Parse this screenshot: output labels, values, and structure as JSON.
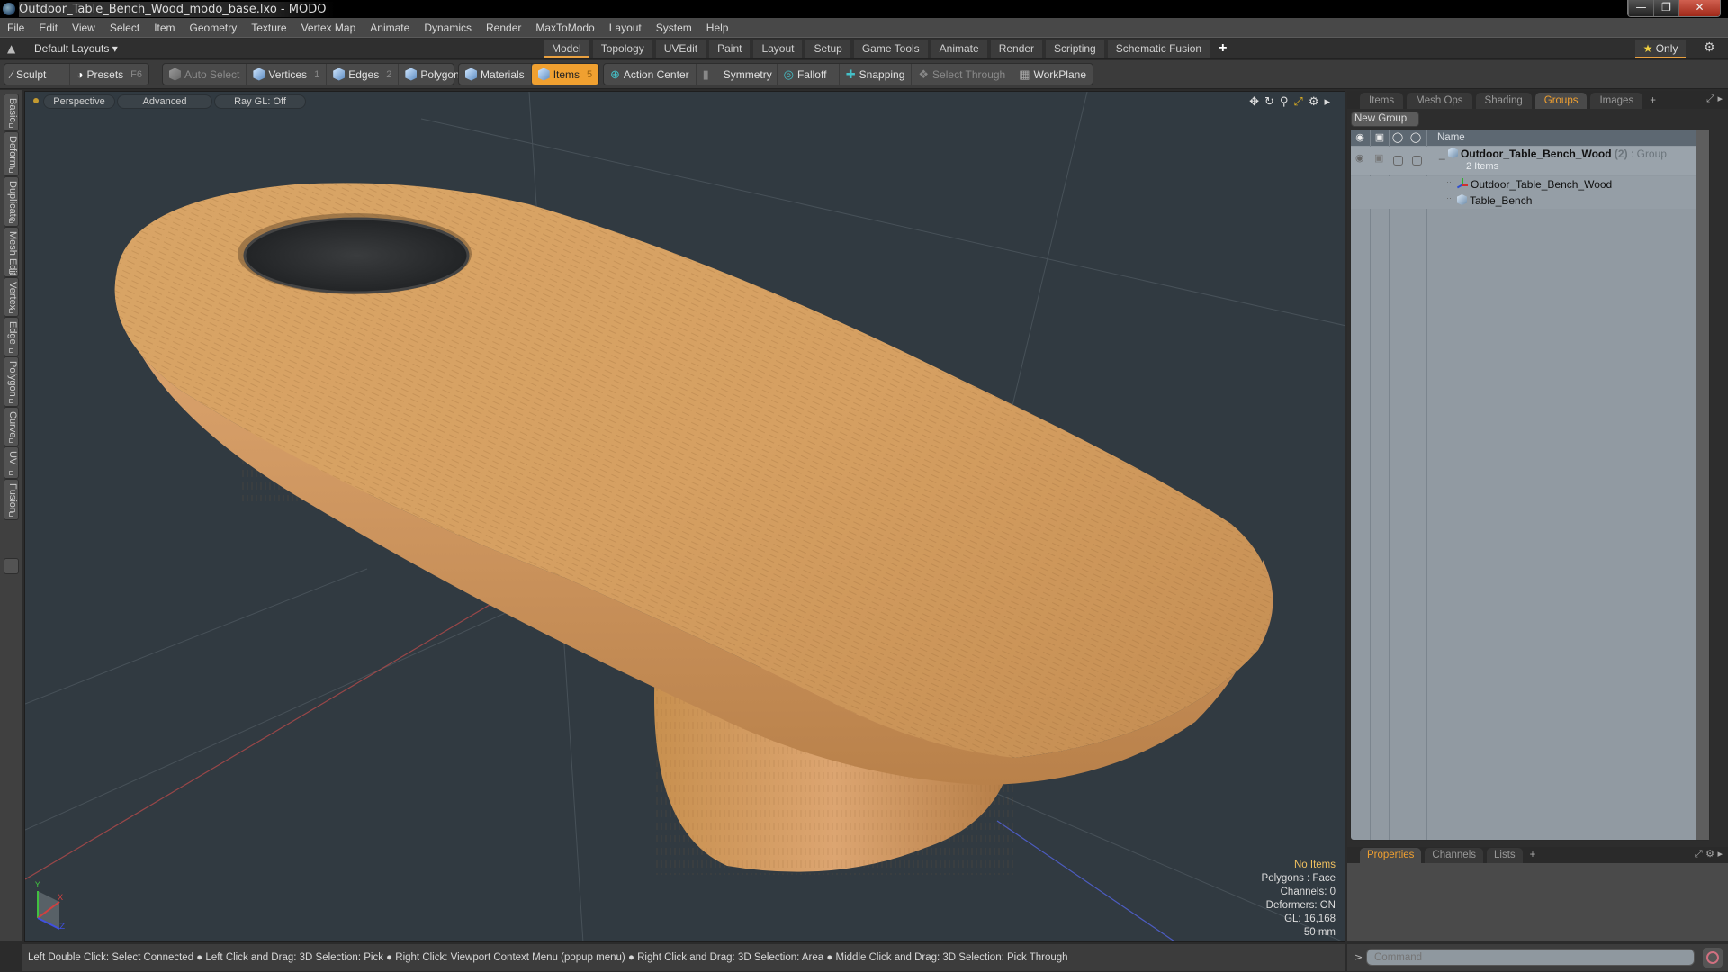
{
  "window": {
    "title": "Outdoor_Table_Bench_Wood_modo_base.lxo - MODO",
    "controls": [
      "minimize",
      "restore",
      "close"
    ]
  },
  "menubar": [
    "File",
    "Edit",
    "View",
    "Select",
    "Item",
    "Geometry",
    "Texture",
    "Vertex Map",
    "Animate",
    "Dynamics",
    "Render",
    "MaxToModo",
    "Layout",
    "System",
    "Help"
  ],
  "layoutbar": {
    "layouts_label": "Default Layouts ▾",
    "tabs": [
      "Model",
      "Topology",
      "UVEdit",
      "Paint",
      "Layout",
      "Setup",
      "Game Tools",
      "Animate",
      "Render",
      "Scripting",
      "Schematic Fusion"
    ],
    "active_tab": "Model",
    "add_tab": "+",
    "only_label": "Only"
  },
  "toolbar": {
    "sculpt": "Sculpt",
    "presets": "Presets",
    "presets_key": "F6",
    "auto_select": "Auto Select",
    "vertices": "Vertices",
    "vertices_count": "1",
    "edges": "Edges",
    "edges_count": "2",
    "polygons": "Polygons",
    "materials": "Materials",
    "items": "Items",
    "items_count": "5",
    "action_center": "Action Center",
    "symmetry": "Symmetry",
    "falloff": "Falloff",
    "snapping": "Snapping",
    "select_through": "Select Through",
    "workplane": "WorkPlane"
  },
  "left_tabs": [
    "Basic",
    "Deform",
    "Duplicate",
    "Mesh Edit",
    "Vertex",
    "Edge",
    "Polygon",
    "Curve",
    "UV",
    "Fusion"
  ],
  "viewport": {
    "view_mode": "Perspective",
    "shading": "Advanced",
    "raygl": "Ray GL: Off",
    "stats": {
      "selection": "No Items",
      "polygons": "Polygons : Face",
      "channels": "Channels: 0",
      "deformers": "Deformers: ON",
      "gl": "GL: 16,168",
      "grid": "50 mm"
    },
    "axis_labels": [
      "Y",
      "X",
      "Z"
    ]
  },
  "statusbar": "Left Double Click: Select Connected ● Left Click and Drag: 3D Selection: Pick ● Right Click: Viewport Context Menu (popup menu) ● Right Click and Drag: 3D Selection: Area ● Middle Click and Drag: 3D Selection: Pick Through",
  "right_panel": {
    "tabs": [
      "Items",
      "Mesh Ops",
      "Shading",
      "Groups",
      "Images"
    ],
    "active_tab": "Groups",
    "new_group": "New Group",
    "column_name": "Name",
    "group": {
      "name": "Outdoor_Table_Bench_Wood",
      "count": "(2)",
      "type": ": Group",
      "subtitle": "2 Items"
    },
    "children": [
      {
        "name": "Outdoor_Table_Bench_Wood",
        "icon": "locator-icon"
      },
      {
        "name": "Table_Bench",
        "icon": "mesh-icon"
      }
    ]
  },
  "bottom_panel": {
    "tabs": [
      "Properties",
      "Channels",
      "Lists"
    ],
    "active_tab": "Properties"
  },
  "command": {
    "placeholder": "Command",
    "prompt": ">"
  }
}
